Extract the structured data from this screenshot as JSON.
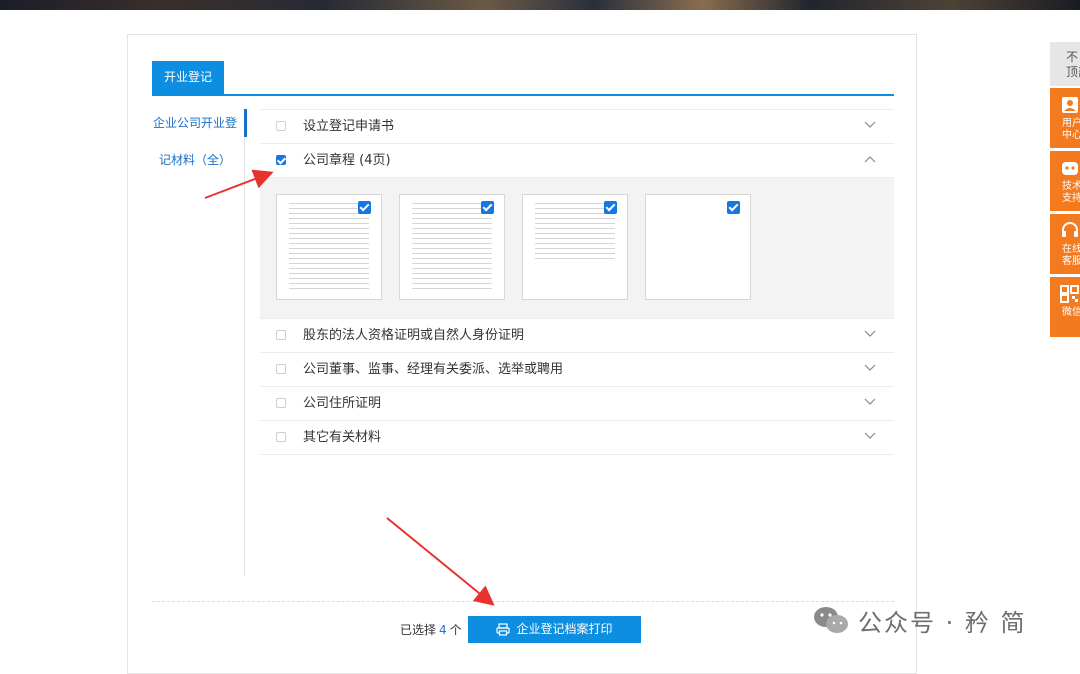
{
  "tabs": {
    "active": "开业登记"
  },
  "sidebar": {
    "item_line1": "企业公司开业登",
    "item_line2": "记材料（全）"
  },
  "materials": [
    {
      "label": "设立登记申请书",
      "checked": false,
      "expanded": false
    },
    {
      "label": "公司章程 (4页)",
      "checked": true,
      "expanded": true
    },
    {
      "label": "股东的法人资格证明或自然人身份证明",
      "checked": false,
      "expanded": false
    },
    {
      "label": "公司董事、监事、经理有关委派、选举或聘用",
      "checked": false,
      "expanded": false
    },
    {
      "label": "公司住所证明",
      "checked": false,
      "expanded": false
    },
    {
      "label": "其它有关材料",
      "checked": false,
      "expanded": false
    }
  ],
  "footer": {
    "selected_prefix": "已选择",
    "selected_count": "4",
    "selected_suffix": "个",
    "print_button": "企业登记档案打印"
  },
  "rail": {
    "top": "不\n顶部",
    "items": [
      "用户\n中心",
      "技术\n支持",
      "在线\n客服",
      "微信"
    ]
  },
  "watermark": "公众号 · 矜 简",
  "icons": {
    "checkbox": "checkbox-icon",
    "chevron_down": "chevron-down-icon",
    "chevron_up": "chevron-up-icon",
    "printer": "printer-icon",
    "user": "user-icon",
    "robot": "robot-icon",
    "headset": "headset-icon",
    "qrcode": "qrcode-icon",
    "wechat": "wechat-icon"
  },
  "colors": {
    "primary": "#0d8ee0",
    "check": "#1677e0",
    "rail": "#f47a20",
    "annotation": "#e8322d"
  }
}
